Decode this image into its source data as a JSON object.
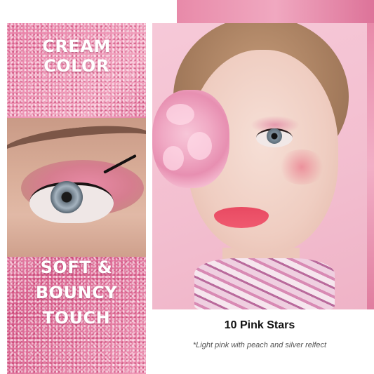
{
  "left_panel": {
    "heading_top": "CREAM COLOR",
    "heading_bottom": "SOFT & BOUNCY TOUCH"
  },
  "product": {
    "shade_name": "10 Pink Stars",
    "shade_description": "*Light pink with peach and silver relfect"
  },
  "colors": {
    "glitter_pink": "#e87fa6",
    "background_pink": "#f3bfd0",
    "heading_text": "#ffffff"
  }
}
